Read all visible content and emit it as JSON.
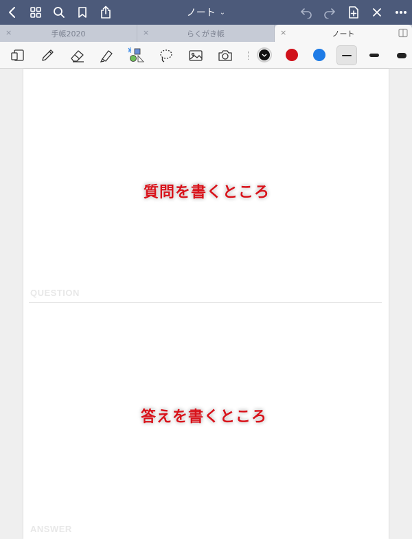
{
  "header": {
    "title": "ノート",
    "back_icon": "chevron-left-icon",
    "grid_icon": "grid-icon",
    "search_icon": "search-icon",
    "bookmark_icon": "bookmark-icon",
    "share_icon": "share-icon",
    "undo_icon": "undo-icon",
    "redo_icon": "redo-icon",
    "add_page_icon": "add-page-icon",
    "close_icon": "close-icon",
    "more_icon": "more-icon"
  },
  "tabs": [
    {
      "label": "手帳2020",
      "close": "×"
    },
    {
      "label": "らくがき帳",
      "close": "×"
    },
    {
      "label": "ノート",
      "close": "×",
      "active": true
    }
  ],
  "toolbar": {
    "tools": [
      "page-thumbnail-icon",
      "pen-icon",
      "eraser-icon",
      "highlighter-icon",
      "shapes-icon",
      "lasso-icon",
      "image-icon",
      "camera-icon"
    ],
    "colors": [
      "#111111",
      "#d0121b",
      "#1e7be6"
    ],
    "selected_color": "#111111",
    "strokes": [
      "thin",
      "medium",
      "thick"
    ],
    "selected_stroke": "thin"
  },
  "page": {
    "question_text": "質問を書くところ",
    "question_label": "QUESTION",
    "answer_text": "答えを書くところ",
    "answer_label": "ANSWER"
  }
}
